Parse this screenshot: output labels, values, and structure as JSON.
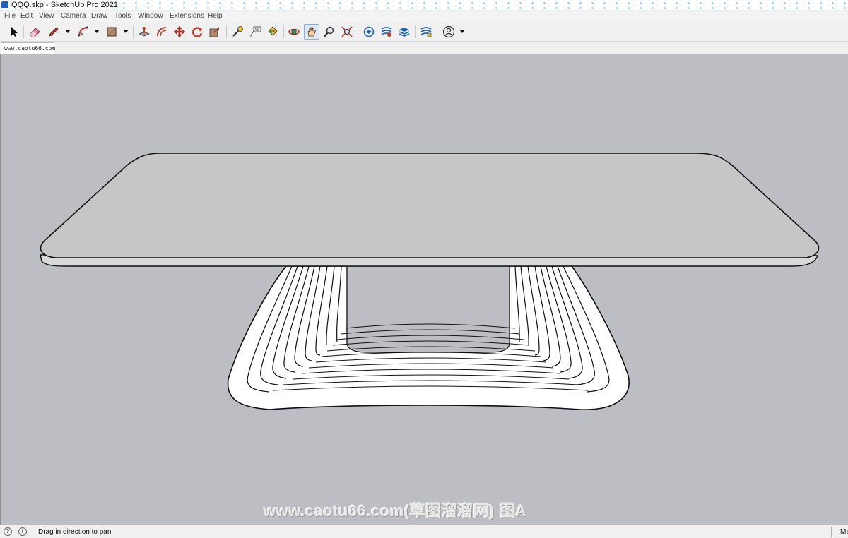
{
  "window": {
    "title": "QQQ.skp - SketchUp Pro 2021"
  },
  "menu": {
    "items": [
      "File",
      "Edit",
      "View",
      "Camera",
      "Draw",
      "Tools",
      "Window",
      "Extensions",
      "Help"
    ]
  },
  "toolbar": {
    "tools": [
      {
        "name": "select-tool",
        "icon": "arrow-cursor-icon"
      },
      {
        "name": "eraser-tool",
        "icon": "eraser-icon"
      },
      {
        "name": "line-tool",
        "icon": "pencil-icon",
        "dropdown": true
      },
      {
        "name": "arc-tool",
        "icon": "arc-icon",
        "dropdown": true
      },
      {
        "name": "shape-tool",
        "icon": "rectangle-icon",
        "dropdown": true
      },
      {
        "name": "push-pull-tool",
        "icon": "push-pull-icon"
      },
      {
        "name": "offset-tool",
        "icon": "offset-icon"
      },
      {
        "name": "move-tool",
        "icon": "move-arrows-icon"
      },
      {
        "name": "rotate-tool",
        "icon": "rotate-icon"
      },
      {
        "name": "scale-tool",
        "icon": "scale-icon"
      },
      {
        "name": "tape-measure-tool",
        "icon": "tape-measure-icon"
      },
      {
        "name": "text-tool",
        "icon": "text-label-icon"
      },
      {
        "name": "paint-bucket-tool",
        "icon": "paint-bucket-icon"
      },
      {
        "name": "orbit-tool",
        "icon": "orbit-icon"
      },
      {
        "name": "pan-tool",
        "icon": "hand-icon",
        "active": true
      },
      {
        "name": "zoom-tool",
        "icon": "magnifier-icon"
      },
      {
        "name": "zoom-extents-tool",
        "icon": "zoom-extents-icon"
      },
      {
        "name": "3d-warehouse-tool",
        "icon": "warehouse-icon"
      },
      {
        "name": "extension-warehouse-tool",
        "icon": "extension-warehouse-icon"
      },
      {
        "name": "layout-tool",
        "icon": "layout-stack-icon"
      },
      {
        "name": "extension-manager-tool",
        "icon": "extension-manager-icon"
      },
      {
        "name": "account-tool",
        "icon": "user-account-icon",
        "dropdown": true
      }
    ]
  },
  "tabs": [
    {
      "label": "www.caotu66.com",
      "active": true
    }
  ],
  "viewport": {
    "watermark": "www.caotu66.com(草图溜溜网) 图A",
    "background_color": "#bcbec3"
  },
  "statusbar": {
    "hint": "Drag in direction to pan",
    "icon_1": "?",
    "icon_2": "i",
    "measurements_label": "Me"
  },
  "colors": {
    "tabletop": "#c6c6c7",
    "edge_line": "#111111",
    "pan_active_bg": "#dbe8f6"
  }
}
